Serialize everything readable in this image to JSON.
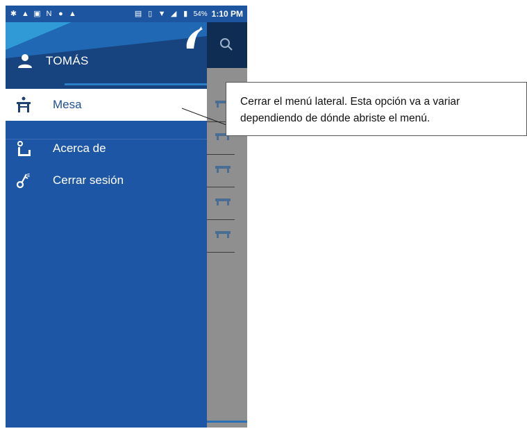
{
  "status_bar": {
    "battery": "54%",
    "time": "1:10 PM",
    "icons": [
      "gear-icon",
      "warning-icon",
      "image-icon",
      "n-icon",
      "s-icon",
      "warning-icon",
      "cast-icon",
      "vibrate-icon",
      "wifi-icon",
      "signal-icon",
      "battery-icon"
    ]
  },
  "drawer": {
    "user_name": "TOMÁS",
    "items": [
      {
        "label": "Mesa",
        "icon": "table-person-icon",
        "active": true
      },
      {
        "label": "Acerca de",
        "icon": "info-person-icon",
        "active": false
      },
      {
        "label": "Cerrar sesión",
        "icon": "key-icon",
        "active": false
      }
    ]
  },
  "callout": {
    "text": "Cerrar el menú lateral. Esta opción va a variar dependiendo de dónde abriste el menú."
  },
  "colors": {
    "drawer_bg": "#1e56a6",
    "header_bg": "#17447f",
    "active_text": "#1e4f96"
  }
}
